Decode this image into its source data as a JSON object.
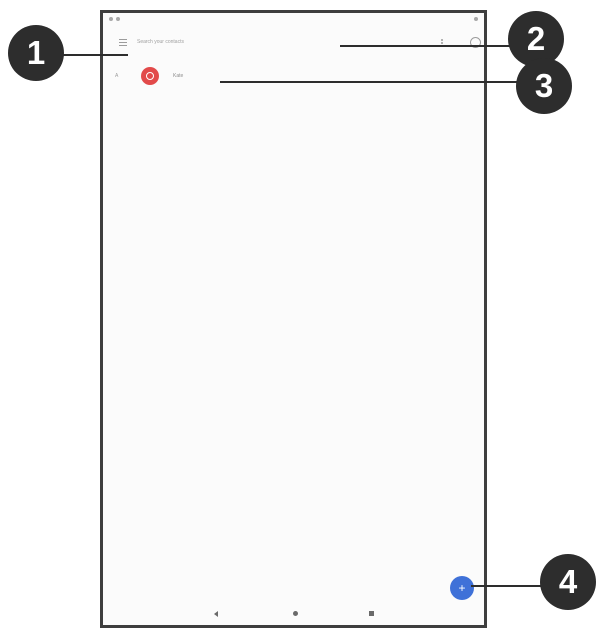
{
  "callouts": [
    "1",
    "2",
    "3",
    "4"
  ],
  "search_bar": {
    "placeholder": "Search your contacts"
  },
  "contacts": [
    {
      "group": "A",
      "name": "Kate"
    }
  ],
  "icons": {
    "menu": "menu-icon",
    "more": "more-vert-icon",
    "account": "account-icon",
    "fab": "plus-icon",
    "nav_back": "back-icon",
    "nav_home": "home-icon",
    "nav_recent": "recent-apps-icon"
  },
  "colors": {
    "avatar": "#e24a4a",
    "fab": "#3f71d8",
    "callout": "#2d2d2d"
  }
}
